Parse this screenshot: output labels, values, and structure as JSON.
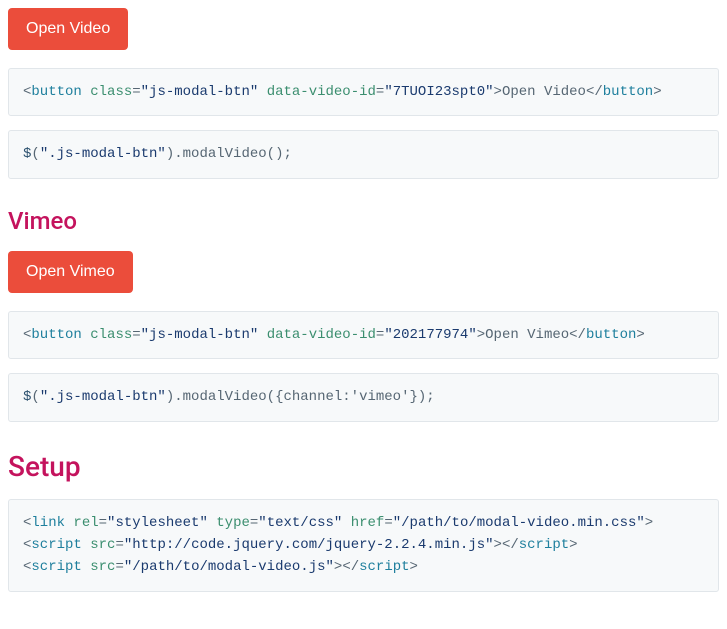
{
  "buttons": {
    "openVideo": "Open Video",
    "openVimeo": "Open Vimeo"
  },
  "headings": {
    "vimeo": "Vimeo",
    "setup": "Setup"
  },
  "code1": {
    "tagOpen": "button",
    "attrClass": "class",
    "valClass": "\"js-modal-btn\"",
    "attrData": "data-video-id",
    "valData": "\"7TUOI23spt0\"",
    "inner": "Open Video",
    "tagClose": "button"
  },
  "code2": {
    "fn": "$",
    "sel": "\".js-modal-btn\"",
    "call": ".modalVideo();"
  },
  "code3": {
    "tagOpen": "button",
    "attrClass": "class",
    "valClass": "\"js-modal-btn\"",
    "attrData": "data-video-id",
    "valData": "\"202177974\"",
    "inner": "Open Vimeo",
    "tagClose": "button"
  },
  "code4": {
    "fn": "$",
    "sel": "\".js-modal-btn\"",
    "call": ".modalVideo({channel:'vimeo'});"
  },
  "code5": {
    "l1": {
      "tag": "link",
      "a1": "rel",
      "v1": "\"stylesheet\"",
      "a2": "type",
      "v2": "\"text/css\"",
      "a3": "href",
      "v3": "\"/path/to/modal-video.min.css\""
    },
    "l2": {
      "tag": "script",
      "a1": "src",
      "v1": "\"http://code.jquery.com/jquery-2.2.4.min.js\"",
      "tagc": "script"
    },
    "l3": {
      "tag": "script",
      "a1": "src",
      "v1": "\"/path/to/modal-video.js\"",
      "tagc": "script"
    }
  }
}
